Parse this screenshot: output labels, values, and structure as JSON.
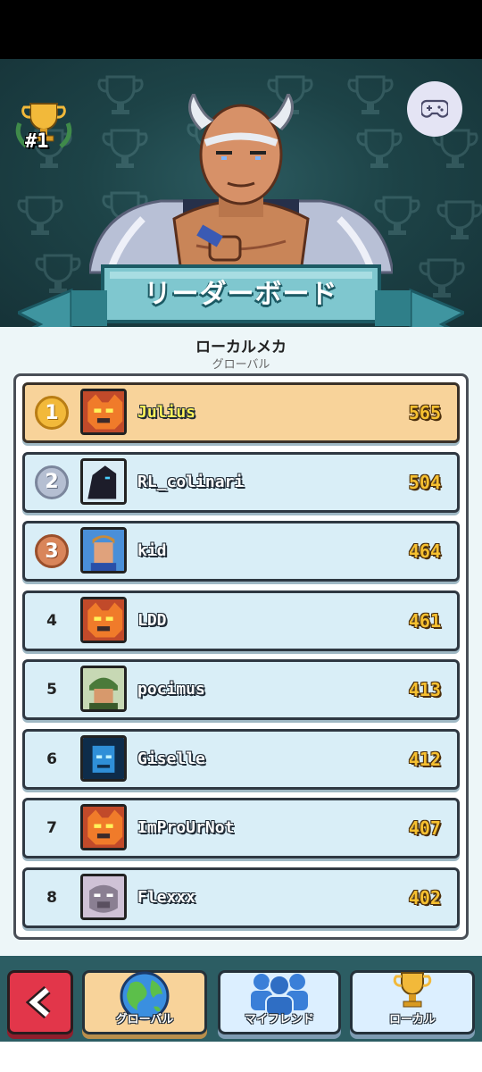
{
  "header": {
    "rank": "#1",
    "banner_title": "リーダーボード",
    "section_title": "ローカルメカ",
    "section_subtitle": "グローバル"
  },
  "leaderboard": [
    {
      "rank": "1",
      "name": "Julius",
      "score": "565",
      "medal": "gold",
      "avatar": "orange-mech"
    },
    {
      "rank": "2",
      "name": "RL_colinari",
      "score": "504",
      "medal": "silver",
      "avatar": "dark-knight"
    },
    {
      "rank": "3",
      "name": "kid",
      "score": "464",
      "medal": "bronze",
      "avatar": "blonde-pilot"
    },
    {
      "rank": "4",
      "name": "LDD",
      "score": "461",
      "medal": "",
      "avatar": "orange-mech"
    },
    {
      "rank": "5",
      "name": "pocimus",
      "score": "413",
      "medal": "",
      "avatar": "soldier"
    },
    {
      "rank": "6",
      "name": "Giselle",
      "score": "412",
      "medal": "",
      "avatar": "blue-cyborg"
    },
    {
      "rank": "7",
      "name": "ImProUrNot",
      "score": "407",
      "medal": "",
      "avatar": "orange-mech"
    },
    {
      "rank": "8",
      "name": "Flexxx",
      "score": "402",
      "medal": "",
      "avatar": "grey-beast"
    }
  ],
  "bottom_nav": {
    "back_icon": "chevron-left-icon",
    "tabs": [
      {
        "label": "グローバル",
        "icon": "globe-icon",
        "active": true
      },
      {
        "label": "マイフレンド",
        "icon": "friends-icon",
        "active": false
      },
      {
        "label": "ローカル",
        "icon": "trophy-icon",
        "active": false
      }
    ]
  },
  "colors": {
    "hero_bg": "#1d4347",
    "row_bg": "#d9eef7",
    "first_row_bg": "#f8d39a",
    "score": "#f6c030",
    "back_button": "#e2364a"
  }
}
